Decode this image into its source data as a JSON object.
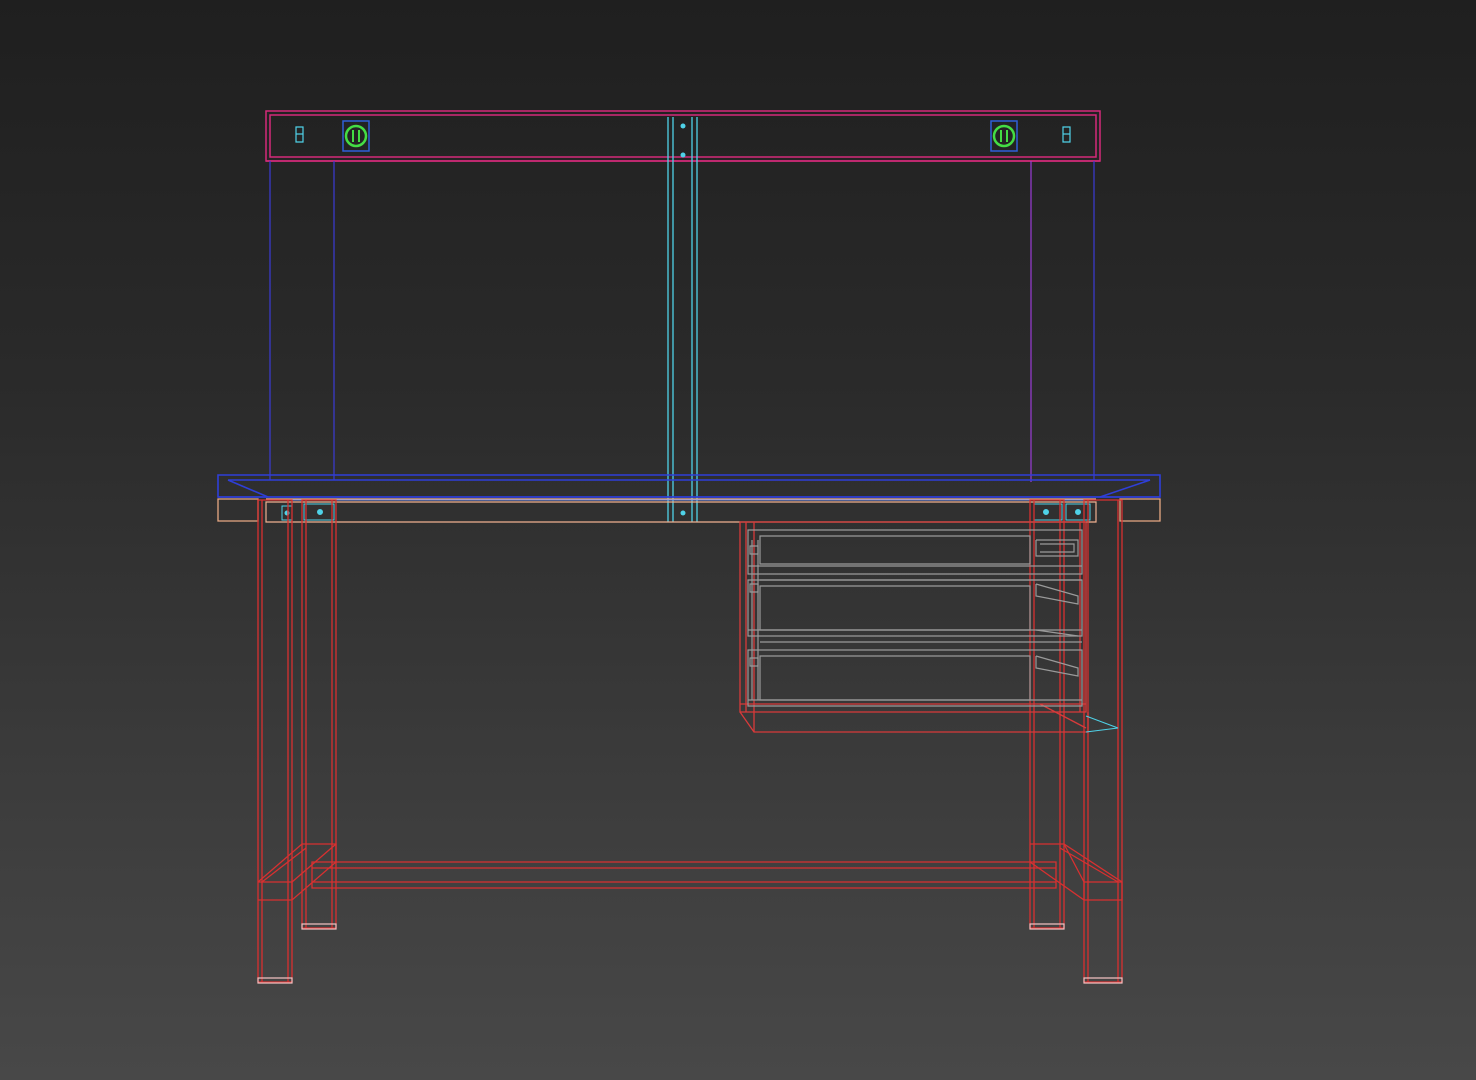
{
  "viewport": {
    "view_type": "wireframe",
    "background_top": "#1f1f1f",
    "background_bottom": "#484848"
  },
  "model": {
    "object": "workbench",
    "parts": [
      {
        "name": "top-shelf-rail",
        "color": "#d42a7a"
      },
      {
        "name": "shelf-uprights",
        "color": "#3b3bd6"
      },
      {
        "name": "right-upright-inner",
        "color": "#9a3cd6"
      },
      {
        "name": "center-divider",
        "color": "#4fd2e8"
      },
      {
        "name": "worktop",
        "color": "#2f3fd8"
      },
      {
        "name": "worktop-edge",
        "color": "#e8a882"
      },
      {
        "name": "apron",
        "color": "#f0b090"
      },
      {
        "name": "frame-legs",
        "color": "#d83030"
      },
      {
        "name": "drawer-unit",
        "color": "#d83a3a"
      },
      {
        "name": "drawer-internals",
        "color": "#9a9a9a"
      },
      {
        "name": "power-sockets",
        "color": "#44dd44"
      },
      {
        "name": "small-fixtures",
        "color": "#4fd2e8"
      }
    ]
  }
}
